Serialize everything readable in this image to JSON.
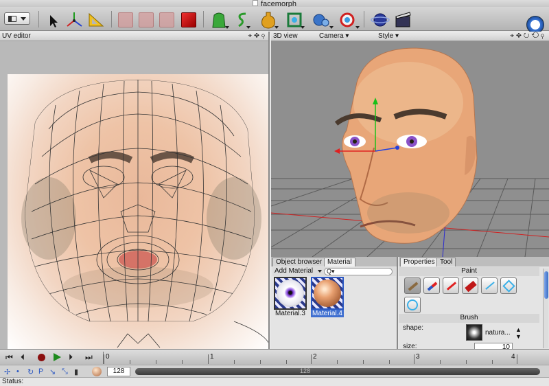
{
  "window": {
    "title": "facemorph"
  },
  "toolbar": {
    "icons": [
      "layout-selector",
      "select-arrow",
      "transform-axes",
      "ruler-triangle",
      "cube-ghost",
      "cube-ghost",
      "cube-ghost",
      "cube-red",
      "green-object",
      "s-curve",
      "bottle",
      "green-frame",
      "blue-spheres",
      "red-ring",
      "planet",
      "clapboard",
      "clock"
    ]
  },
  "uv_editor": {
    "title": "UV editor"
  },
  "view3d": {
    "title": "3D view",
    "camera_label": "Camera",
    "style_label": "Style"
  },
  "object_browser": {
    "tabs": [
      {
        "label": "Object browser"
      },
      {
        "label": "Material"
      }
    ],
    "add_material_label": "Add Material",
    "search_placeholder": "Q▾",
    "materials": [
      {
        "name": "Material.3"
      },
      {
        "name": "Material.4"
      }
    ]
  },
  "properties": {
    "tabs": [
      {
        "label": "Properties"
      },
      {
        "label": "Tool"
      }
    ],
    "paint_title": "Paint",
    "brush_title": "Brush",
    "shape_label": "shape:",
    "shape_value": "natura...",
    "size_label": "size:",
    "size_value": "10"
  },
  "timeline": {
    "ticks": [
      "0",
      "1",
      "2",
      "3",
      "4"
    ],
    "subtick": "0",
    "frame_value": "128",
    "slider_value": "128",
    "slider_fraction": 0.42
  },
  "status": {
    "label": "Status:"
  },
  "colors": {
    "accent": "#3f6fd0",
    "record": "#8b1010",
    "play": "#1d8a1d"
  }
}
